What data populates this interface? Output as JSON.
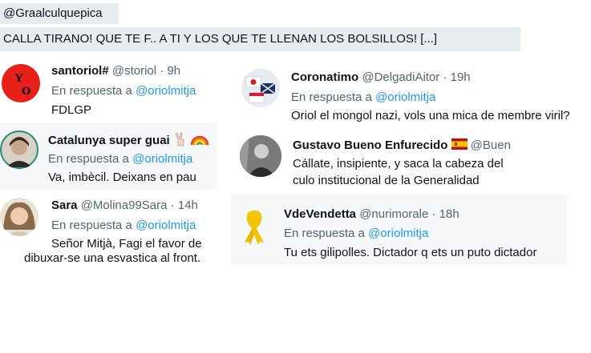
{
  "header": {
    "handle": "@Graalculquepica",
    "quote": "CALLA TIRANO! QUE TE F.. A TI Y LOS QUE TE LLENAN LOS BOLSILLOS! [...]"
  },
  "colors": {
    "link": "#1d9bf0",
    "muted": "#536471",
    "text": "#0f1419",
    "highlight": "#e7ecf0"
  },
  "replies": [
    {
      "name": "santoriol#",
      "handle": "@storiol",
      "time": "· 9h",
      "reply_prefix": "En respuesta a",
      "mention": "@oriolmitja",
      "text": "FDLGP",
      "avatar_text": "Y O"
    },
    {
      "name": "Catalunya super guai",
      "emojis": [
        "victory-hand-icon",
        "rainbow-icon"
      ],
      "reply_prefix": "En respuesta a",
      "mention": "@oriolmitja",
      "text": "Va, imbècil. Deixans en pau"
    },
    {
      "name": "Sara",
      "handle": "@Molina99Sara",
      "time": "· 14h",
      "reply_prefix": "En respuesta a",
      "mention": "@oriolmitja",
      "text_line1": "Señor Mitjà, Fagi el favor de",
      "text_line2": "dibuxar-se una esvastica al front."
    },
    {
      "name": "Coronatimo",
      "handle": "@DelgadiAitor",
      "time": "· 19h",
      "reply_prefix": "En respuesta a",
      "mention": "@oriolmitja",
      "text": "Oriol el mongol nazi, vols una mica de membre viril?"
    },
    {
      "name": "Gustavo Bueno Enfurecido",
      "flag": "spain-flag-icon",
      "handle": "@Buen",
      "text_line1": "Cállate, insipiente, y saca la cabeza del",
      "text_line2": "culo institucional de la Generalidad"
    },
    {
      "name": "VdeVendetta",
      "handle": "@nurimorale",
      "time": "· 18h",
      "reply_prefix": "En respuesta a",
      "mention": "@oriolmitja",
      "text": "Tu ets gilipolles. Dictador q ets un puto dictador",
      "avatar_icon": "yellow-ribbon-icon"
    }
  ]
}
